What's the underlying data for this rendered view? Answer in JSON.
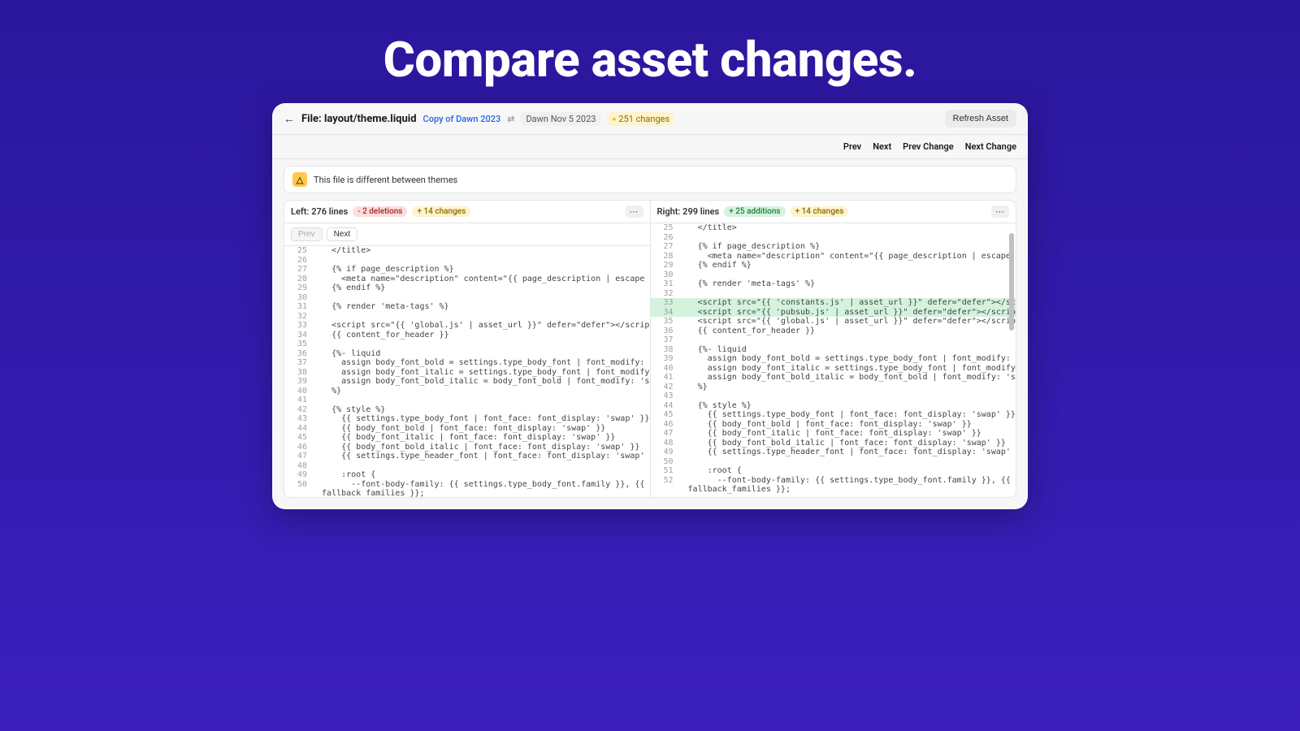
{
  "hero": {
    "title": "Compare asset changes."
  },
  "header": {
    "file_prefix": "File:",
    "file_path": "layout/theme.liquid",
    "left_theme": "Copy of Dawn 2023",
    "right_theme": "Dawn Nov 5 2023",
    "changes_label": "251 changes",
    "refresh_label": "Refresh Asset"
  },
  "nav": {
    "prev": "Prev",
    "next": "Next",
    "prev_change": "Prev Change",
    "next_change": "Next Change"
  },
  "alert": {
    "text": "This file is different between themes"
  },
  "left": {
    "title": "Left: 276 lines",
    "deletions": "- 2 deletions",
    "changes": "+ 14 changes",
    "prev": "Prev",
    "next": "Next"
  },
  "right": {
    "title": "Right: 299 lines",
    "additions": "+ 25 additions",
    "changes": "+ 14 changes"
  },
  "left_code": [
    {
      "n": 25,
      "t": "    </title>"
    },
    {
      "n": 26,
      "t": ""
    },
    {
      "n": 27,
      "t": "    {% if page_description %}"
    },
    {
      "n": 28,
      "t": "      <meta name=\"description\" content=\"{{ page_description | escape }}\">"
    },
    {
      "n": 29,
      "t": "    {% endif %}"
    },
    {
      "n": 30,
      "t": ""
    },
    {
      "n": 31,
      "t": "    {% render 'meta-tags' %}"
    },
    {
      "n": 32,
      "t": ""
    },
    {
      "n": "",
      "t": "",
      "cls": "row-empty"
    },
    {
      "n": "",
      "t": "",
      "cls": "row-empty"
    },
    {
      "n": 33,
      "t": "    <script src=\"{{ 'global.js' | asset_url }}\" defer=\"defer\"></script>"
    },
    {
      "n": 34,
      "t": "    {{ content_for_header }}"
    },
    {
      "n": 35,
      "t": ""
    },
    {
      "n": 36,
      "t": "    {%- liquid"
    },
    {
      "n": 37,
      "t": "      assign body_font_bold = settings.type_body_font | font_modify: 'weight', 'bold'"
    },
    {
      "n": 38,
      "t": "      assign body_font_italic = settings.type_body_font | font_modify: 'style', 'italic'"
    },
    {
      "n": 39,
      "t": "      assign body_font_bold_italic = body_font_bold | font_modify: 'style', 'italic'"
    },
    {
      "n": 40,
      "t": "    %}"
    },
    {
      "n": 41,
      "t": ""
    },
    {
      "n": 42,
      "t": "    {% style %}"
    },
    {
      "n": 43,
      "t": "      {{ settings.type_body_font | font_face: font_display: 'swap' }}"
    },
    {
      "n": 44,
      "t": "      {{ body_font_bold | font_face: font_display: 'swap' }}"
    },
    {
      "n": 45,
      "t": "      {{ body_font_italic | font_face: font_display: 'swap' }}"
    },
    {
      "n": 46,
      "t": "      {{ body_font_bold_italic | font_face: font_display: 'swap' }}"
    },
    {
      "n": 47,
      "t": "      {{ settings.type_header_font | font_face: font_display: 'swap' }}"
    },
    {
      "n": 48,
      "t": ""
    },
    {
      "n": 49,
      "t": "      :root {"
    },
    {
      "n": 50,
      "t": "        --font-body-family: {{ settings.type_body_font.family }}, {{ settings.type_body_font."
    },
    {
      "n": "",
      "t": "  fallback_families }};"
    }
  ],
  "right_code": [
    {
      "n": 25,
      "t": "    </title>"
    },
    {
      "n": 26,
      "t": ""
    },
    {
      "n": 27,
      "t": "    {% if page_description %}"
    },
    {
      "n": 28,
      "t": "      <meta name=\"description\" content=\"{{ page_description | escape }}\">"
    },
    {
      "n": 29,
      "t": "    {% endif %}"
    },
    {
      "n": 30,
      "t": ""
    },
    {
      "n": 31,
      "t": "    {% render 'meta-tags' %}"
    },
    {
      "n": 32,
      "t": ""
    },
    {
      "n": 33,
      "t": "    <script src=\"{{ 'constants.js' | asset_url }}\" defer=\"defer\"></script>",
      "cls": "row-added"
    },
    {
      "n": 34,
      "t": "    <script src=\"{{ 'pubsub.js' | asset_url }}\" defer=\"defer\"></script>",
      "cls": "row-added"
    },
    {
      "n": 35,
      "t": "    <script src=\"{{ 'global.js' | asset_url }}\" defer=\"defer\"></script>"
    },
    {
      "n": 36,
      "t": "    {{ content_for_header }}"
    },
    {
      "n": 37,
      "t": ""
    },
    {
      "n": 38,
      "t": "    {%- liquid"
    },
    {
      "n": 39,
      "t": "      assign body_font_bold = settings.type_body_font | font_modify: 'weight', 'bold'"
    },
    {
      "n": 40,
      "t": "      assign body_font_italic = settings.type_body_font | font_modify: 'style', 'italic'"
    },
    {
      "n": 41,
      "t": "      assign body_font_bold_italic = body_font_bold | font_modify: 'style', 'italic'"
    },
    {
      "n": 42,
      "t": "    %}"
    },
    {
      "n": 43,
      "t": ""
    },
    {
      "n": 44,
      "t": "    {% style %}"
    },
    {
      "n": 45,
      "t": "      {{ settings.type_body_font | font_face: font_display: 'swap' }}"
    },
    {
      "n": 46,
      "t": "      {{ body_font_bold | font_face: font_display: 'swap' }}"
    },
    {
      "n": 47,
      "t": "      {{ body_font_italic | font_face: font_display: 'swap' }}"
    },
    {
      "n": 48,
      "t": "      {{ body_font_bold_italic | font_face: font_display: 'swap' }}"
    },
    {
      "n": 49,
      "t": "      {{ settings.type_header_font | font_face: font_display: 'swap' }}"
    },
    {
      "n": 50,
      "t": ""
    },
    {
      "n": 51,
      "t": "      :root {"
    },
    {
      "n": 52,
      "t": "        --font-body-family: {{ settings.type_body_font.family }}, {{ settings.type_body_font."
    },
    {
      "n": "",
      "t": "  fallback_families }};"
    }
  ]
}
